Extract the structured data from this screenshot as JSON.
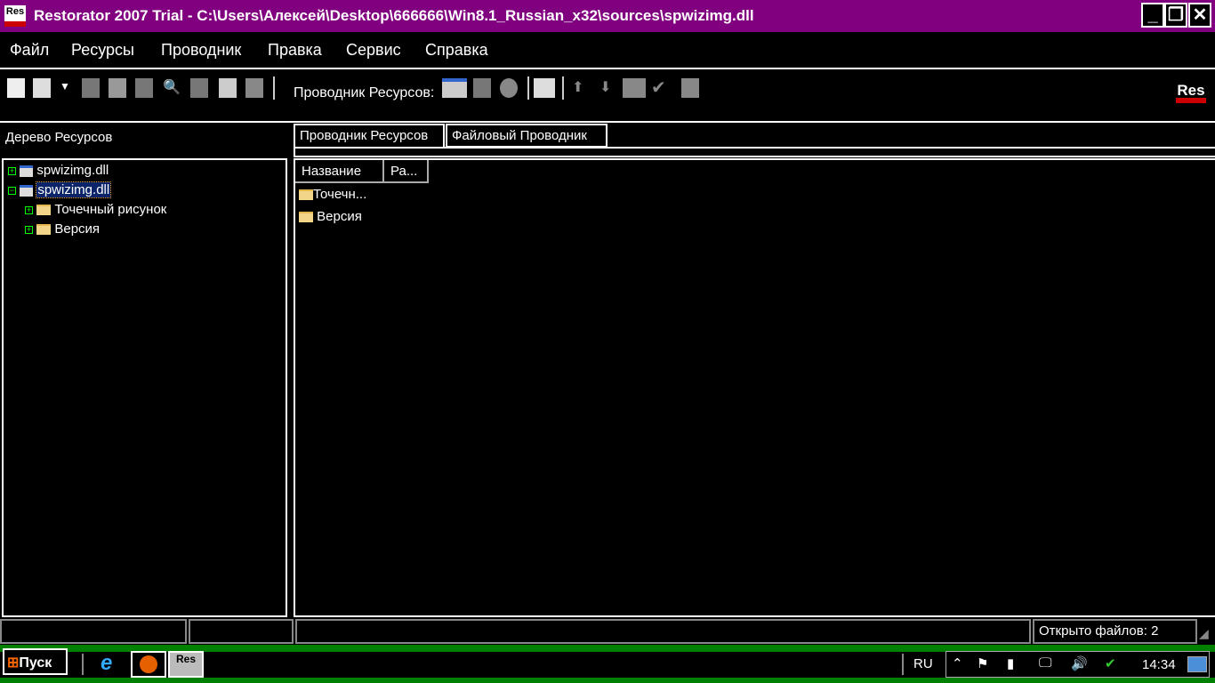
{
  "window": {
    "title": "Restorator 2007 Trial - C:\\Users\\Алексей\\Desktop\\666666\\Win8.1_Russian_x32\\sources\\spwizimg.dll",
    "icon_text": "Res",
    "buttons": [
      "_",
      "❐",
      "✕"
    ]
  },
  "menu": [
    "Файл",
    "Ресурсы",
    "Проводник",
    "Правка",
    "Сервис",
    "Справка"
  ],
  "toolbar": {
    "label": "Проводник Ресурсов:",
    "logo": "Res"
  },
  "left_pane": {
    "title": "Дерево Ресурсов",
    "tree": [
      {
        "label": "spwizimg.dll",
        "expander": "+"
      },
      {
        "label": "spwizimg.dll",
        "expander": "−",
        "selected": true
      },
      {
        "label": "Точечный рисунок",
        "expander": "+"
      },
      {
        "label": "Версия",
        "expander": "+"
      }
    ]
  },
  "tabs": [
    "Проводник Ресурсов",
    "Файловый Проводник"
  ],
  "list": {
    "columns": [
      "Название",
      "Ра..."
    ],
    "items": [
      "Точечн...",
      "Версия"
    ]
  },
  "status": {
    "files_open": "Открыто файлов: 2"
  },
  "taskbar": {
    "start": "Пуск",
    "lang": "RU",
    "clock": "14:34",
    "apps": [
      "e",
      "Res"
    ]
  }
}
